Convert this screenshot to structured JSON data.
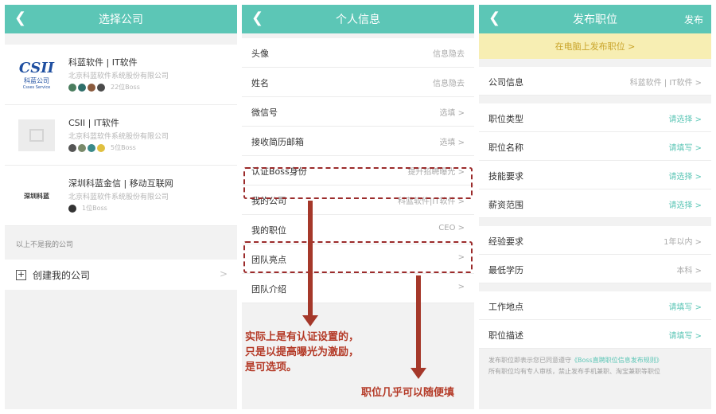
{
  "colors": {
    "accent": "#5cc6b6",
    "annotation": "#b43a27",
    "banner": "#f7eeb3"
  },
  "panel1": {
    "title": "选择公司",
    "companies": [
      {
        "logo_text": "CSII",
        "logo_sub": "科蓝公司",
        "logo_sub2": "Csses Service",
        "name": "科蓝软件 | IT软件",
        "full_name": "北京科蓝软件系统股份有限公司",
        "members_note": "22位Boss"
      },
      {
        "logo_text": "",
        "name": "CSII | IT软件",
        "full_name": "北京科蓝软件系统股份有限公司",
        "members_note": "5位Boss"
      },
      {
        "logo_text": "深圳科蓝",
        "name": "深圳科蓝金信 | 移动互联网",
        "full_name": "北京科蓝软件系统股份有限公司",
        "members_note": "1位Boss"
      }
    ],
    "not_mine_label": "以上不是我的公司",
    "create_label": "创建我的公司"
  },
  "panel2": {
    "title": "个人信息",
    "rows": [
      {
        "label": "头像",
        "value": "信息隐去"
      },
      {
        "label": "姓名",
        "value": "信息隐去"
      },
      {
        "label": "微信号",
        "value": "选填 >"
      },
      {
        "label": "接收简历邮箱",
        "value": "选填 >"
      },
      {
        "label": "认证Boss身份",
        "value": "提升招聘曝光 >"
      },
      {
        "label": "我的公司",
        "value": "科蓝软件|IT软件 >"
      },
      {
        "label": "我的职位",
        "value": "CEO >"
      },
      {
        "label": "团队亮点",
        "value": ">"
      },
      {
        "label": "团队介绍",
        "value": ">"
      }
    ],
    "annotation1": [
      "实际上是有认证设置的，",
      "只是以提高曝光为激励，",
      "是可选项。"
    ],
    "annotation2": "职位几乎可以随便填"
  },
  "panel3": {
    "title": "发布职位",
    "publish_label": "发布",
    "banner": "在电脑上发布职位 >",
    "rows": [
      {
        "label": "公司信息",
        "value": "科蓝软件 | IT软件 >",
        "teal": false
      },
      {
        "label": "职位类型",
        "value": "请选择 >",
        "teal": true
      },
      {
        "label": "职位名称",
        "value": "请填写 >",
        "teal": true
      },
      {
        "label": "技能要求",
        "value": "请选择 >",
        "teal": true
      },
      {
        "label": "薪资范围",
        "value": "请选择 >",
        "teal": true
      },
      {
        "label": "经验要求",
        "value": "1年以内 >",
        "teal": false
      },
      {
        "label": "最低学历",
        "value": "本科 >",
        "teal": false
      },
      {
        "label": "工作地点",
        "value": "请填写 >",
        "teal": true
      },
      {
        "label": "职位描述",
        "value": "请填写 >",
        "teal": true
      }
    ],
    "note_pre": "发布职位即表示您已同意遵守",
    "note_link": "《Boss直聘职位信息发布规则》",
    "note_line2": "所有职位均有专人审核，禁止发布手机兼职、淘宝兼职等职位"
  }
}
